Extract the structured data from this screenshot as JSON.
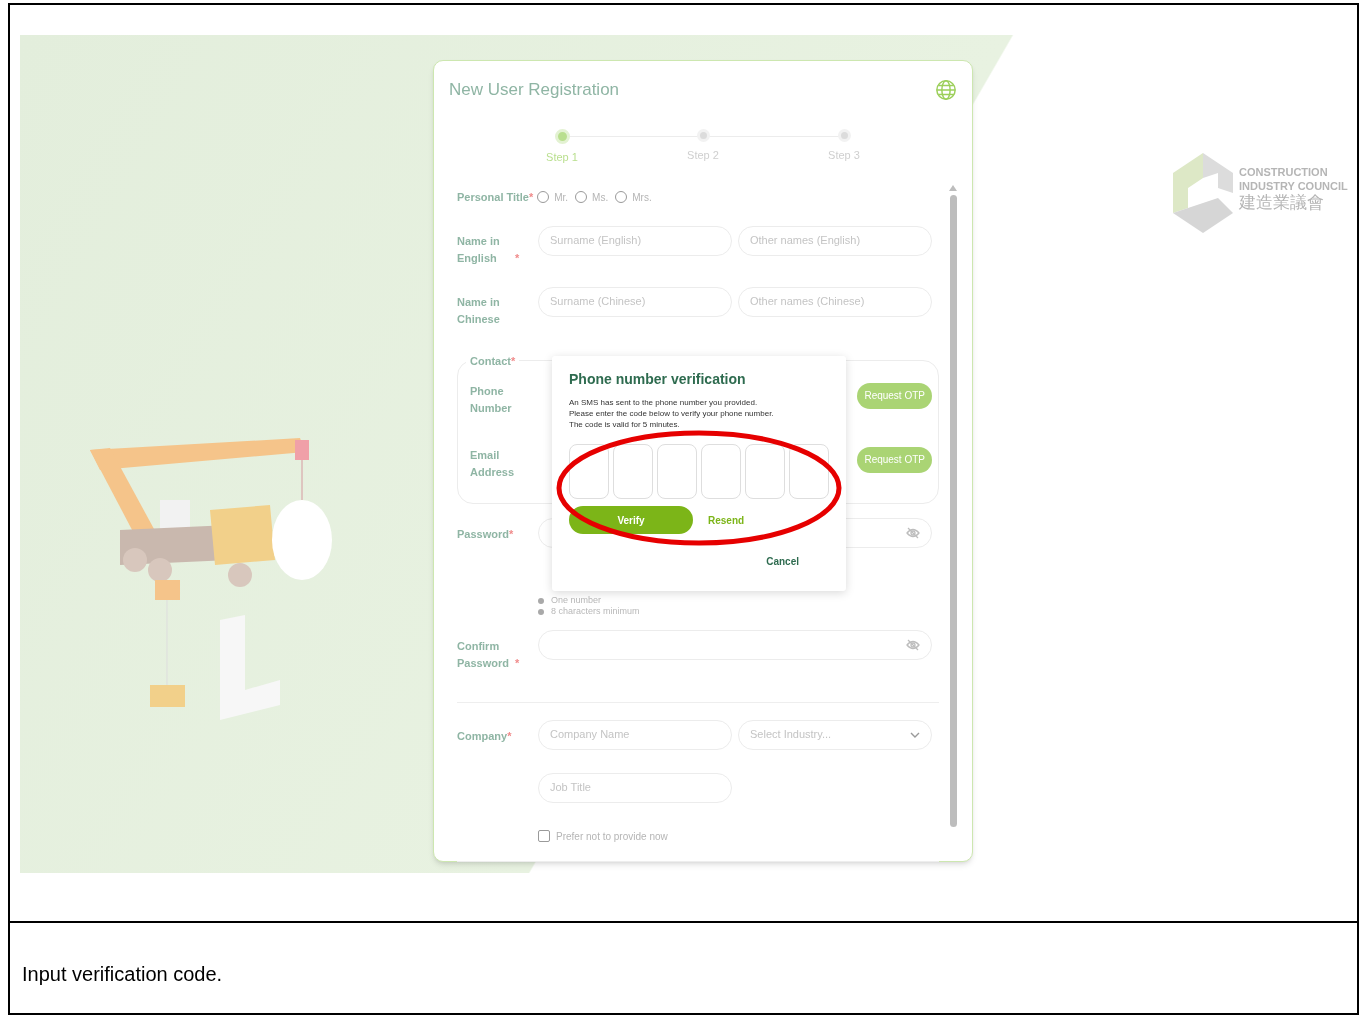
{
  "screen": {
    "logo": {
      "lines": [
        "CONSTRUCTION",
        "INDUSTRY COUNCIL"
      ],
      "chinese": "建造業議會"
    },
    "form": {
      "title": "New User Registration",
      "steps": [
        {
          "label": "Step 1",
          "selected": true
        },
        {
          "label": "Step 2",
          "selected": false
        },
        {
          "label": "Step 3",
          "selected": false
        }
      ],
      "personal_title": {
        "label": "Personal Title",
        "required_mark": "*",
        "options": [
          {
            "label": "Mr.",
            "selected": false
          },
          {
            "label": "Ms.",
            "selected": false
          },
          {
            "label": "Mrs.",
            "selected": false
          }
        ]
      },
      "name_rows": [
        {
          "label": "Name in English",
          "required_mark": "*",
          "fields": [
            {
              "placeholder": "Surname (English)"
            },
            {
              "placeholder": "Other names (English)"
            }
          ]
        },
        {
          "label": "Name in Chinese",
          "fields": [
            {
              "placeholder": "Surname (Chinese)"
            },
            {
              "placeholder": "Other names (Chinese)"
            }
          ]
        }
      ],
      "contact": {
        "legend": "Contact",
        "required_mark": "*",
        "items": [
          {
            "label": "Phone Number",
            "button": "Request OTP"
          },
          {
            "label": "Email Address",
            "button": "Request OTP"
          }
        ]
      },
      "password": {
        "label": "Password",
        "required_mark": "*",
        "hints": [
          "One number",
          "8 characters minimum"
        ]
      },
      "confirm_password": {
        "label": "Confirm Password",
        "required_mark": "*"
      },
      "company": {
        "label": "Company",
        "required_mark": "*",
        "company_name": {
          "placeholder": "Company Name"
        },
        "industry": {
          "placeholder": "Select Industry..."
        },
        "job_title": {
          "placeholder": "Job Title"
        },
        "prefer_not": {
          "label": "Prefer not to provide now",
          "checked": false
        }
      }
    },
    "dialog": {
      "title": "Phone number verification",
      "message": [
        "An SMS has sent to the phone number you provided.",
        "Please enter the code below to verify your phone number.",
        "The code is valid for 5 minutes."
      ],
      "code_boxes": [
        {
          "filled": false
        },
        {
          "filled": false
        },
        {
          "filled": false
        },
        {
          "filled": false
        },
        {
          "filled": false
        },
        {
          "filled": false
        }
      ],
      "verify": "Verify",
      "resend": "Resend",
      "cancel": "Cancel"
    }
  },
  "caption": "Input verification code."
}
